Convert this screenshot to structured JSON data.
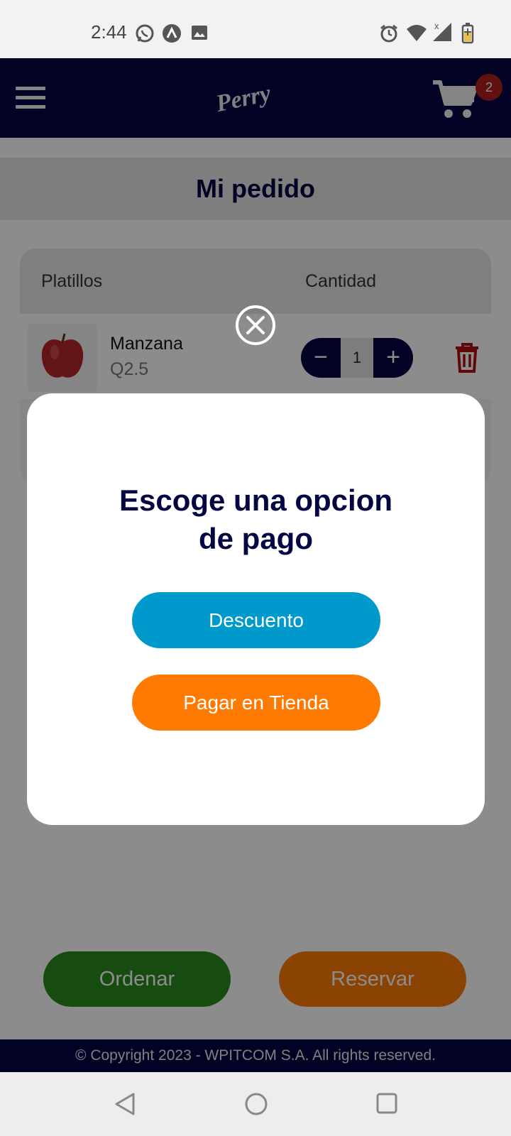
{
  "status_bar": {
    "time": "2:44"
  },
  "header": {
    "brand": "Perry",
    "cart_count": "2"
  },
  "page": {
    "title": "Mi pedido",
    "columns": [
      "Platillos",
      "Cantidad"
    ],
    "items": [
      {
        "name": "Manzana",
        "price": "Q2.5",
        "quantity": "1"
      }
    ],
    "order_button": "Ordenar",
    "reserve_button": "Reservar"
  },
  "footer": {
    "copyright": "© Copyright 2023 - WPITCOM S.A. All rights reserved."
  },
  "modal": {
    "title_line1": "Escoge una opcion",
    "title_line2": "de pago",
    "discount_button": "Descuento",
    "store_pay_button": "Pagar en Tienda"
  },
  "colors": {
    "brand_navy": "#040643",
    "discount_blue": "#0099cc",
    "orange": "#ff7a00",
    "green": "#2b8a1e",
    "badge_red": "#b22020"
  },
  "icons": [
    "whatsapp-icon",
    "arc-icon",
    "gallery-icon",
    "alarm-icon",
    "wifi-icon",
    "signal-icon",
    "battery-icon",
    "menu-icon",
    "cart-icon",
    "trash-icon",
    "close-icon",
    "back-icon",
    "home-icon",
    "recents-icon"
  ]
}
